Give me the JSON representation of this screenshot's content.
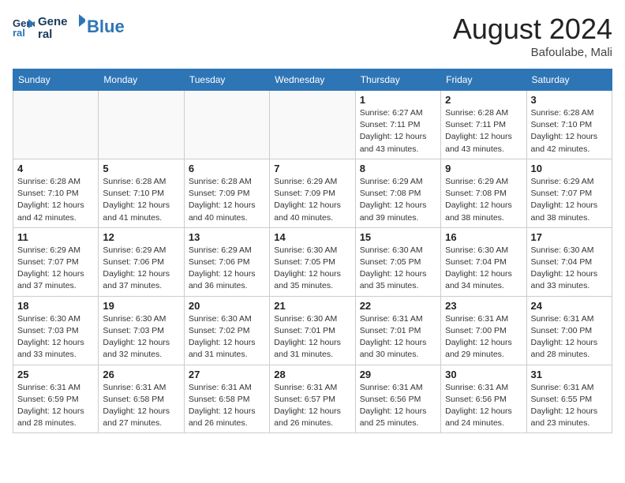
{
  "header": {
    "logo_line1": "General",
    "logo_line2": "Blue",
    "month_year": "August 2024",
    "location": "Bafoulabe, Mali"
  },
  "weekdays": [
    "Sunday",
    "Monday",
    "Tuesday",
    "Wednesday",
    "Thursday",
    "Friday",
    "Saturday"
  ],
  "weeks": [
    [
      {
        "day": "",
        "info": ""
      },
      {
        "day": "",
        "info": ""
      },
      {
        "day": "",
        "info": ""
      },
      {
        "day": "",
        "info": ""
      },
      {
        "day": "1",
        "info": "Sunrise: 6:27 AM\nSunset: 7:11 PM\nDaylight: 12 hours\nand 43 minutes."
      },
      {
        "day": "2",
        "info": "Sunrise: 6:28 AM\nSunset: 7:11 PM\nDaylight: 12 hours\nand 43 minutes."
      },
      {
        "day": "3",
        "info": "Sunrise: 6:28 AM\nSunset: 7:10 PM\nDaylight: 12 hours\nand 42 minutes."
      }
    ],
    [
      {
        "day": "4",
        "info": "Sunrise: 6:28 AM\nSunset: 7:10 PM\nDaylight: 12 hours\nand 42 minutes."
      },
      {
        "day": "5",
        "info": "Sunrise: 6:28 AM\nSunset: 7:10 PM\nDaylight: 12 hours\nand 41 minutes."
      },
      {
        "day": "6",
        "info": "Sunrise: 6:28 AM\nSunset: 7:09 PM\nDaylight: 12 hours\nand 40 minutes."
      },
      {
        "day": "7",
        "info": "Sunrise: 6:29 AM\nSunset: 7:09 PM\nDaylight: 12 hours\nand 40 minutes."
      },
      {
        "day": "8",
        "info": "Sunrise: 6:29 AM\nSunset: 7:08 PM\nDaylight: 12 hours\nand 39 minutes."
      },
      {
        "day": "9",
        "info": "Sunrise: 6:29 AM\nSunset: 7:08 PM\nDaylight: 12 hours\nand 38 minutes."
      },
      {
        "day": "10",
        "info": "Sunrise: 6:29 AM\nSunset: 7:07 PM\nDaylight: 12 hours\nand 38 minutes."
      }
    ],
    [
      {
        "day": "11",
        "info": "Sunrise: 6:29 AM\nSunset: 7:07 PM\nDaylight: 12 hours\nand 37 minutes."
      },
      {
        "day": "12",
        "info": "Sunrise: 6:29 AM\nSunset: 7:06 PM\nDaylight: 12 hours\nand 37 minutes."
      },
      {
        "day": "13",
        "info": "Sunrise: 6:29 AM\nSunset: 7:06 PM\nDaylight: 12 hours\nand 36 minutes."
      },
      {
        "day": "14",
        "info": "Sunrise: 6:30 AM\nSunset: 7:05 PM\nDaylight: 12 hours\nand 35 minutes."
      },
      {
        "day": "15",
        "info": "Sunrise: 6:30 AM\nSunset: 7:05 PM\nDaylight: 12 hours\nand 35 minutes."
      },
      {
        "day": "16",
        "info": "Sunrise: 6:30 AM\nSunset: 7:04 PM\nDaylight: 12 hours\nand 34 minutes."
      },
      {
        "day": "17",
        "info": "Sunrise: 6:30 AM\nSunset: 7:04 PM\nDaylight: 12 hours\nand 33 minutes."
      }
    ],
    [
      {
        "day": "18",
        "info": "Sunrise: 6:30 AM\nSunset: 7:03 PM\nDaylight: 12 hours\nand 33 minutes."
      },
      {
        "day": "19",
        "info": "Sunrise: 6:30 AM\nSunset: 7:03 PM\nDaylight: 12 hours\nand 32 minutes."
      },
      {
        "day": "20",
        "info": "Sunrise: 6:30 AM\nSunset: 7:02 PM\nDaylight: 12 hours\nand 31 minutes."
      },
      {
        "day": "21",
        "info": "Sunrise: 6:30 AM\nSunset: 7:01 PM\nDaylight: 12 hours\nand 31 minutes."
      },
      {
        "day": "22",
        "info": "Sunrise: 6:31 AM\nSunset: 7:01 PM\nDaylight: 12 hours\nand 30 minutes."
      },
      {
        "day": "23",
        "info": "Sunrise: 6:31 AM\nSunset: 7:00 PM\nDaylight: 12 hours\nand 29 minutes."
      },
      {
        "day": "24",
        "info": "Sunrise: 6:31 AM\nSunset: 7:00 PM\nDaylight: 12 hours\nand 28 minutes."
      }
    ],
    [
      {
        "day": "25",
        "info": "Sunrise: 6:31 AM\nSunset: 6:59 PM\nDaylight: 12 hours\nand 28 minutes."
      },
      {
        "day": "26",
        "info": "Sunrise: 6:31 AM\nSunset: 6:58 PM\nDaylight: 12 hours\nand 27 minutes."
      },
      {
        "day": "27",
        "info": "Sunrise: 6:31 AM\nSunset: 6:58 PM\nDaylight: 12 hours\nand 26 minutes."
      },
      {
        "day": "28",
        "info": "Sunrise: 6:31 AM\nSunset: 6:57 PM\nDaylight: 12 hours\nand 26 minutes."
      },
      {
        "day": "29",
        "info": "Sunrise: 6:31 AM\nSunset: 6:56 PM\nDaylight: 12 hours\nand 25 minutes."
      },
      {
        "day": "30",
        "info": "Sunrise: 6:31 AM\nSunset: 6:56 PM\nDaylight: 12 hours\nand 24 minutes."
      },
      {
        "day": "31",
        "info": "Sunrise: 6:31 AM\nSunset: 6:55 PM\nDaylight: 12 hours\nand 23 minutes."
      }
    ]
  ]
}
